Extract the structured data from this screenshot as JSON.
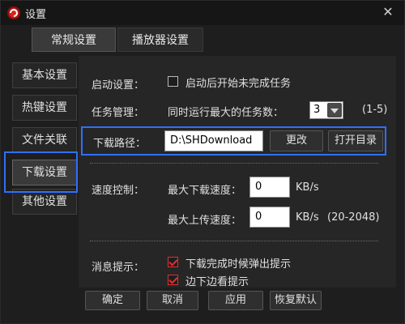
{
  "window": {
    "title": "设置",
    "close_icon": "close-icon"
  },
  "top_tabs": [
    {
      "label": "常规设置",
      "active": true
    },
    {
      "label": "播放器设置",
      "active": false
    }
  ],
  "sidebar": {
    "items": [
      {
        "label": "基本设置",
        "active": false
      },
      {
        "label": "热键设置",
        "active": false
      },
      {
        "label": "文件关联",
        "active": false
      },
      {
        "label": "下载设置",
        "active": true
      },
      {
        "label": "其他设置",
        "active": false
      }
    ]
  },
  "startup": {
    "label": "启动设置：",
    "checkbox_label": "启动后开始未完成任务",
    "checked": false
  },
  "task": {
    "label": "任务管理：",
    "text": "同时运行最大的任务数：",
    "value": "3",
    "range": "(1-5)"
  },
  "download_path": {
    "label": "下载路径：",
    "value": "D:\\SHDownload",
    "change_button": "更改",
    "open_button": "打开目录"
  },
  "speed": {
    "label": "速度控制：",
    "max_download_label": "最大下载速度：",
    "max_download_value": "0",
    "download_unit": "KB/s",
    "max_upload_label": "最大上传速度：",
    "max_upload_value": "0",
    "upload_unit": "KB/s",
    "upload_range": "(20-2048)"
  },
  "notice": {
    "label": "消息提示：",
    "item1": "下载完成时候弹出提示",
    "item1_checked": true,
    "item2": "边下边看提示",
    "item2_checked": true
  },
  "footer": {
    "ok": "确定",
    "cancel": "取消",
    "apply": "应用",
    "restore": "恢复默认"
  },
  "colors": {
    "highlight": "#2f6fff",
    "check": "#e03030",
    "brand": "#d6231f"
  }
}
